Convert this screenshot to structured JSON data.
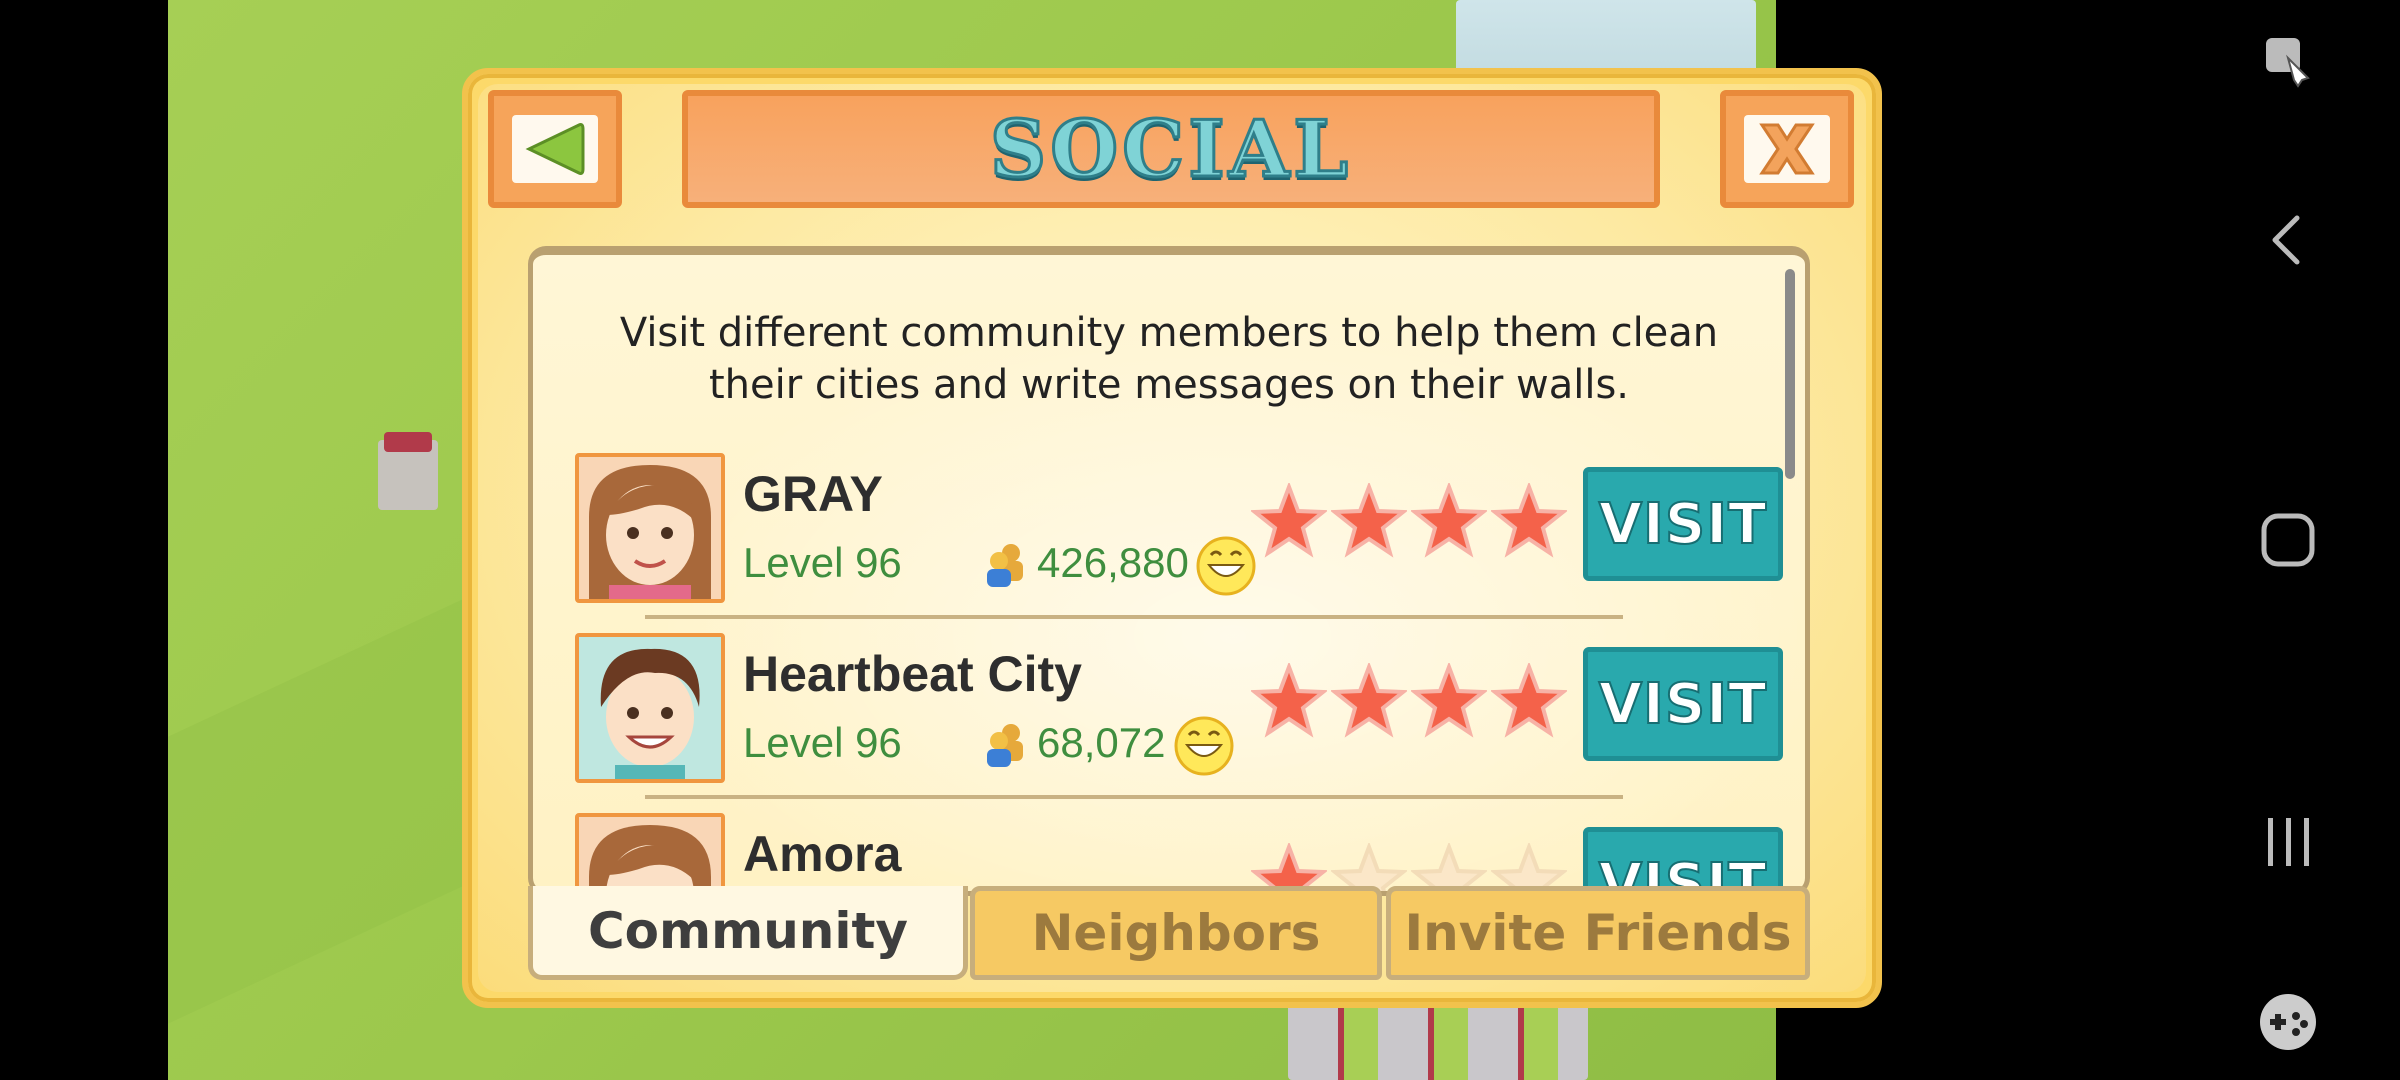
{
  "dialog": {
    "title": "SOCIAL",
    "intro": "Visit different community members to help them clean their cities and write messages on their walls."
  },
  "members": [
    {
      "name": "GRAY",
      "level": "Level 96",
      "population": "426,880",
      "rating": 4,
      "visit_label": "VISIT"
    },
    {
      "name": "Heartbeat City",
      "level": "Level 96",
      "population": "68,072",
      "rating": 4,
      "visit_label": "VISIT"
    },
    {
      "name": "Amora",
      "level": "",
      "population": "",
      "rating": 1,
      "visit_label": "VISIT"
    }
  ],
  "tabs": [
    {
      "label": "Community",
      "active": true
    },
    {
      "label": "Neighbors",
      "active": false
    },
    {
      "label": "Invite Friends",
      "active": false
    }
  ],
  "icons": {
    "back": "left-arrow-icon",
    "close": "close-icon",
    "population": "people-icon",
    "happiness": "smile-icon",
    "star": "star-icon"
  },
  "colors": {
    "visit_button": "#29a9ad",
    "title_bar": "#f8a25d",
    "star_full": "#f4624a",
    "level_text": "#3f8e3f"
  },
  "android_nav": [
    "screenshot-icon",
    "back-icon",
    "home-icon",
    "recents-icon",
    "game-tools-icon"
  ]
}
